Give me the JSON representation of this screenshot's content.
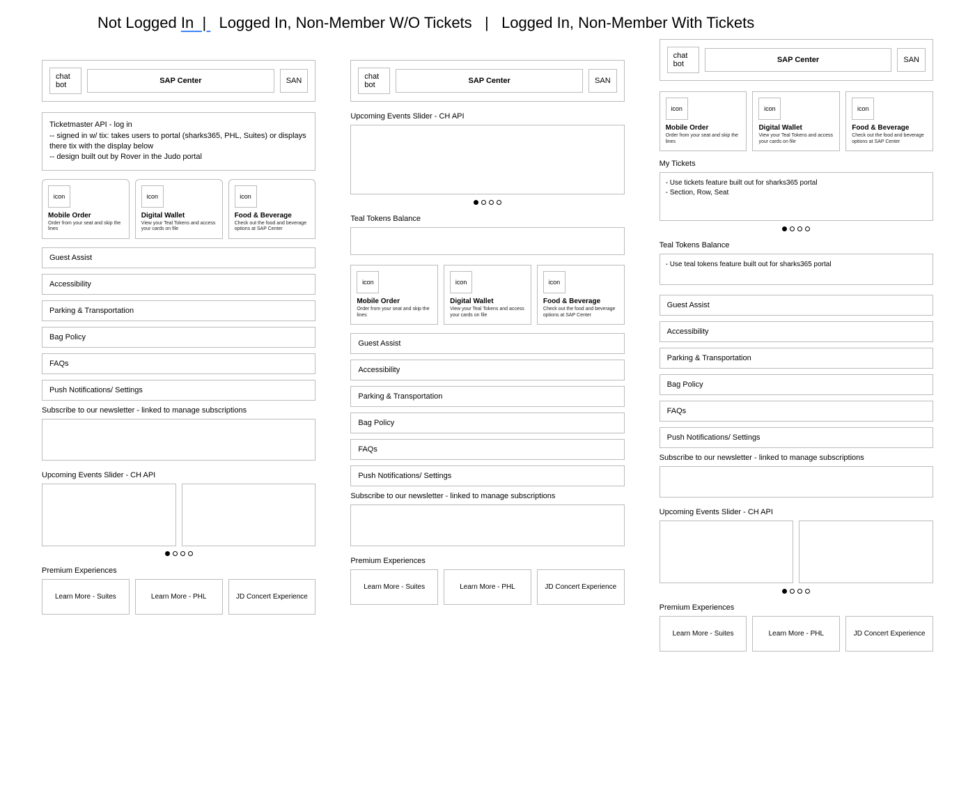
{
  "pageTitle": {
    "seg1": "Not Logged ",
    "seg_in": "In",
    "sep": "   |   ",
    "seg2": "Logged In, Non-Member W/O Tickets",
    "seg3": "Logged In, Non-Member With Tickets"
  },
  "topbar": {
    "chatbot": "chat bot",
    "center": "SAP Center",
    "right": "SAN"
  },
  "noteBox": {
    "title": "Ticketmaster API - log in",
    "line1": "-- signed in w/ tix: takes users to portal (sharks365, PHL, Suites) or displays there tix with the display below",
    "line2": "-- design built out by Rover in the Judo portal"
  },
  "iconCards": [
    {
      "icon": "icon",
      "title": "Mobile Order",
      "sub": "Order from your seat and skip the lines"
    },
    {
      "icon": "icon",
      "title": "Digital Wallet",
      "sub": "View your Teal Tokens and access your cards on file"
    },
    {
      "icon": "icon",
      "title": "Food & Beverage",
      "sub": "Check out the food and beverage options at SAP Center"
    }
  ],
  "listItems": [
    "Guest Assist",
    "Accessibility",
    "Parking & Transportation",
    "Bag Policy",
    "FAQs",
    "Push Notifications/ Settings"
  ],
  "newsletter": "Subscribe to our newsletter - linked to manage subscriptions",
  "upcomingLabel": "Upcoming Events Slider - CH API",
  "premiumLabel": "Premium Experiences",
  "premiumCards": [
    "Learn More - Suites",
    "Learn More - PHL",
    "JD Concert Experience"
  ],
  "tealLabel": "Teal Tokens Balance",
  "myTicketsLabel": "My Tickets",
  "ticketBox": {
    "line1": "- Use tickets feature built out for sharks365 portal",
    "line2": "- Section, Row, Seat"
  },
  "tokensBox": "- Use teal tokens feature built out for sharks365 portal"
}
